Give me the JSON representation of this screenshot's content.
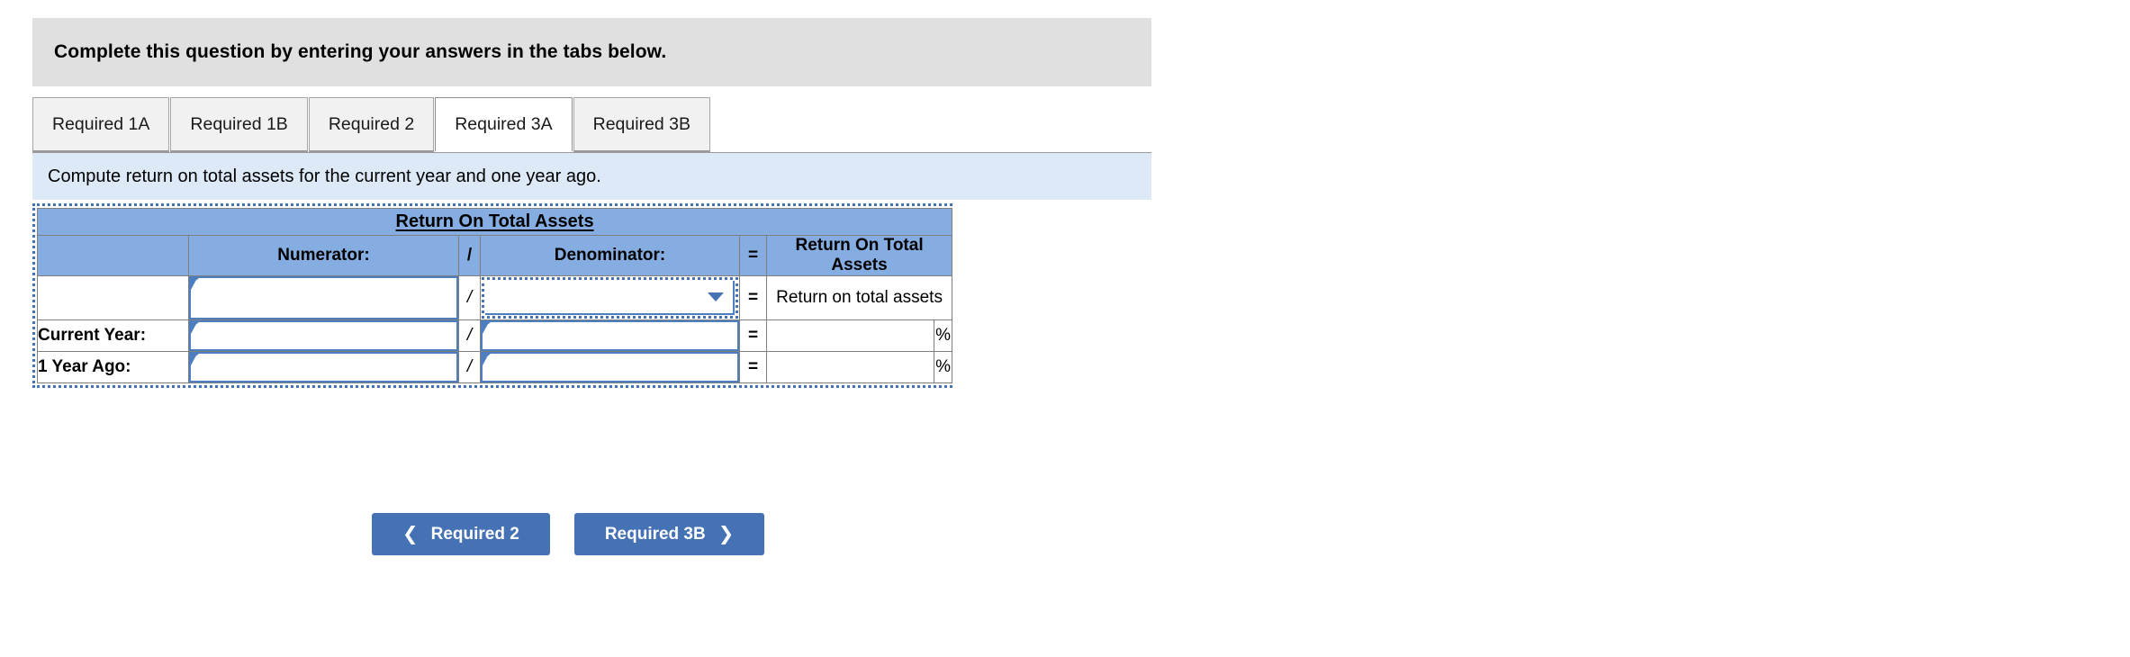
{
  "banner": {
    "text": "Complete this question by entering your answers in the tabs below."
  },
  "tabs": {
    "items": [
      {
        "label": "Required 1A",
        "active": false
      },
      {
        "label": "Required 1B",
        "active": false
      },
      {
        "label": "Required 2",
        "active": false
      },
      {
        "label": "Required 3A",
        "active": true
      },
      {
        "label": "Required 3B",
        "active": false
      }
    ]
  },
  "instruction": {
    "text": "Compute return on total assets for the current year and one year ago."
  },
  "worksheet": {
    "title": "Return On Total Assets",
    "columns": {
      "label": "",
      "numerator": "Numerator:",
      "slash": "/",
      "denominator": "Denominator:",
      "equals": "=",
      "result": "Return On Total Assets"
    },
    "rows": [
      {
        "label": "",
        "numerator_value": "",
        "slash": "/",
        "denominator_value": "",
        "denominator_is_dropdown": true,
        "equals": "=",
        "result_value": "Return on total assets",
        "percent": ""
      },
      {
        "label": "Current Year:",
        "numerator_value": "",
        "slash": "/",
        "denominator_value": "",
        "denominator_is_dropdown": false,
        "equals": "=",
        "result_value": "",
        "percent": "%"
      },
      {
        "label": "1 Year Ago:",
        "numerator_value": "",
        "slash": "/",
        "denominator_value": "",
        "denominator_is_dropdown": false,
        "equals": "=",
        "result_value": "",
        "percent": "%"
      }
    ]
  },
  "nav": {
    "prev_label": "Required 2",
    "prev_icon": "chevron-left-icon",
    "next_label": "Required 3B",
    "next_icon": "chevron-right-icon"
  },
  "colors": {
    "banner_bg": "#e0e0e0",
    "instruction_bg": "#dde9f7",
    "table_header_bg": "#85ADE1",
    "accent_blue": "#4472b4",
    "field_border": "#4d7ebf",
    "tab_inactive_bg": "#f1f1f1",
    "tab_active_bg": "#ffffff"
  }
}
